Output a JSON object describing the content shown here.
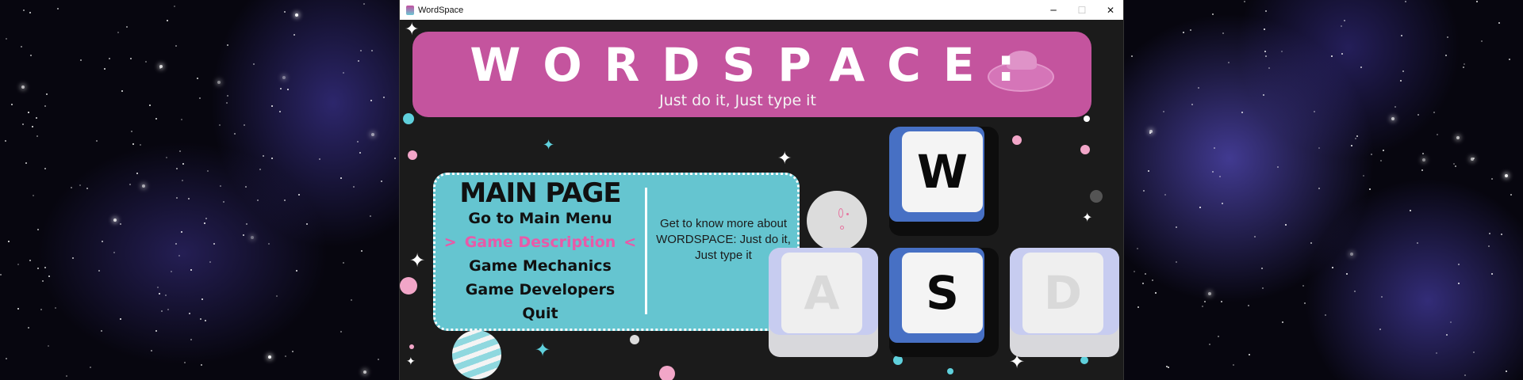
{
  "window": {
    "title": "WordSpace",
    "controls": {
      "minimize": "─",
      "maximize": "☐",
      "close": "✕"
    }
  },
  "banner": {
    "title": "WORDSPACE:",
    "subtitle": "Just do it, Just type it"
  },
  "menu": {
    "heading": "MAIN PAGE",
    "items": [
      {
        "label": "Go to Main Menu",
        "active": false
      },
      {
        "label": "Game Description",
        "active": true
      },
      {
        "label": "Game Mechanics",
        "active": false
      },
      {
        "label": "Game Developers",
        "active": false
      },
      {
        "label": "Quit",
        "active": false
      }
    ],
    "selection_markers": {
      "left": ">",
      "right": "<"
    },
    "description": "Get to know more about WORDSPACE: Just do it, Just type it"
  },
  "keys": {
    "w": "W",
    "a": "A",
    "s": "S",
    "d": "D"
  },
  "colors": {
    "banner": "#c4549e",
    "menu_card": "#65c5d0",
    "active_item": "#e85aa8",
    "key_accent": "#4770c4",
    "game_bg": "#1b1b1b"
  },
  "icons": {
    "app": "wordspace-app-icon",
    "decorations": [
      "sparkle-icon",
      "moon-face",
      "planet",
      "ufo"
    ]
  }
}
